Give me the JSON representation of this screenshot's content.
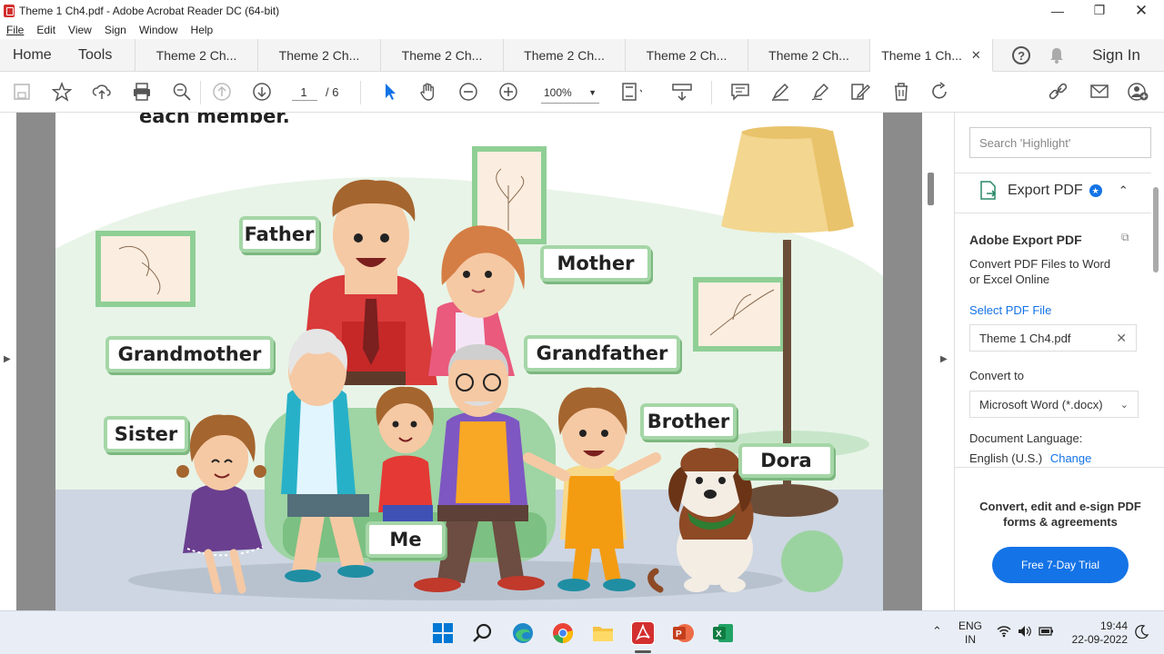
{
  "window": {
    "title": "Theme 1 Ch4.pdf - Adobe Acrobat Reader DC (64-bit)"
  },
  "menu": [
    "File",
    "Edit",
    "View",
    "Sign",
    "Window",
    "Help"
  ],
  "tabs": {
    "home": "Home",
    "tools": "Tools",
    "docs": [
      "Theme 2 Ch...",
      "Theme 2 Ch...",
      "Theme 2 Ch...",
      "Theme 2 Ch...",
      "Theme 2 Ch...",
      "Theme 2 Ch..."
    ],
    "active_doc": "Theme 1 Ch...",
    "sign_in": "Sign In"
  },
  "toolbar": {
    "page_current": "1",
    "page_total": "/ 6",
    "zoom": "100%"
  },
  "page_content": {
    "heading_partial": "each member.",
    "labels": {
      "father": "Father",
      "mother": "Mother",
      "grandmother": "Grandmother",
      "grandfather": "Grandfather",
      "sister": "Sister",
      "brother": "Brother",
      "me": "Me",
      "dora": "Dora"
    }
  },
  "right_panel": {
    "search_placeholder": "Search 'Highlight'",
    "export_title": "Export PDF",
    "section_title": "Adobe Export PDF",
    "description": "Convert PDF Files to Word or Excel Online",
    "select_file": "Select PDF File",
    "file_name": "Theme 1 Ch4.pdf",
    "convert_to_label": "Convert to",
    "convert_to_value": "Microsoft Word (*.docx)",
    "doc_language_label": "Document Language:",
    "doc_language_value": "English (U.S.)",
    "change_link": "Change",
    "promo_text": "Convert, edit and e-sign PDF forms & agreements",
    "trial_button": "Free 7-Day Trial"
  },
  "taskbar": {
    "lang1": "ENG",
    "lang2": "IN",
    "time": "19:44",
    "date": "22-09-2022"
  },
  "colors": {
    "accent_blue": "#1473e6",
    "label_green": "#a5d6a7",
    "pdf_red": "#d32f2f"
  }
}
